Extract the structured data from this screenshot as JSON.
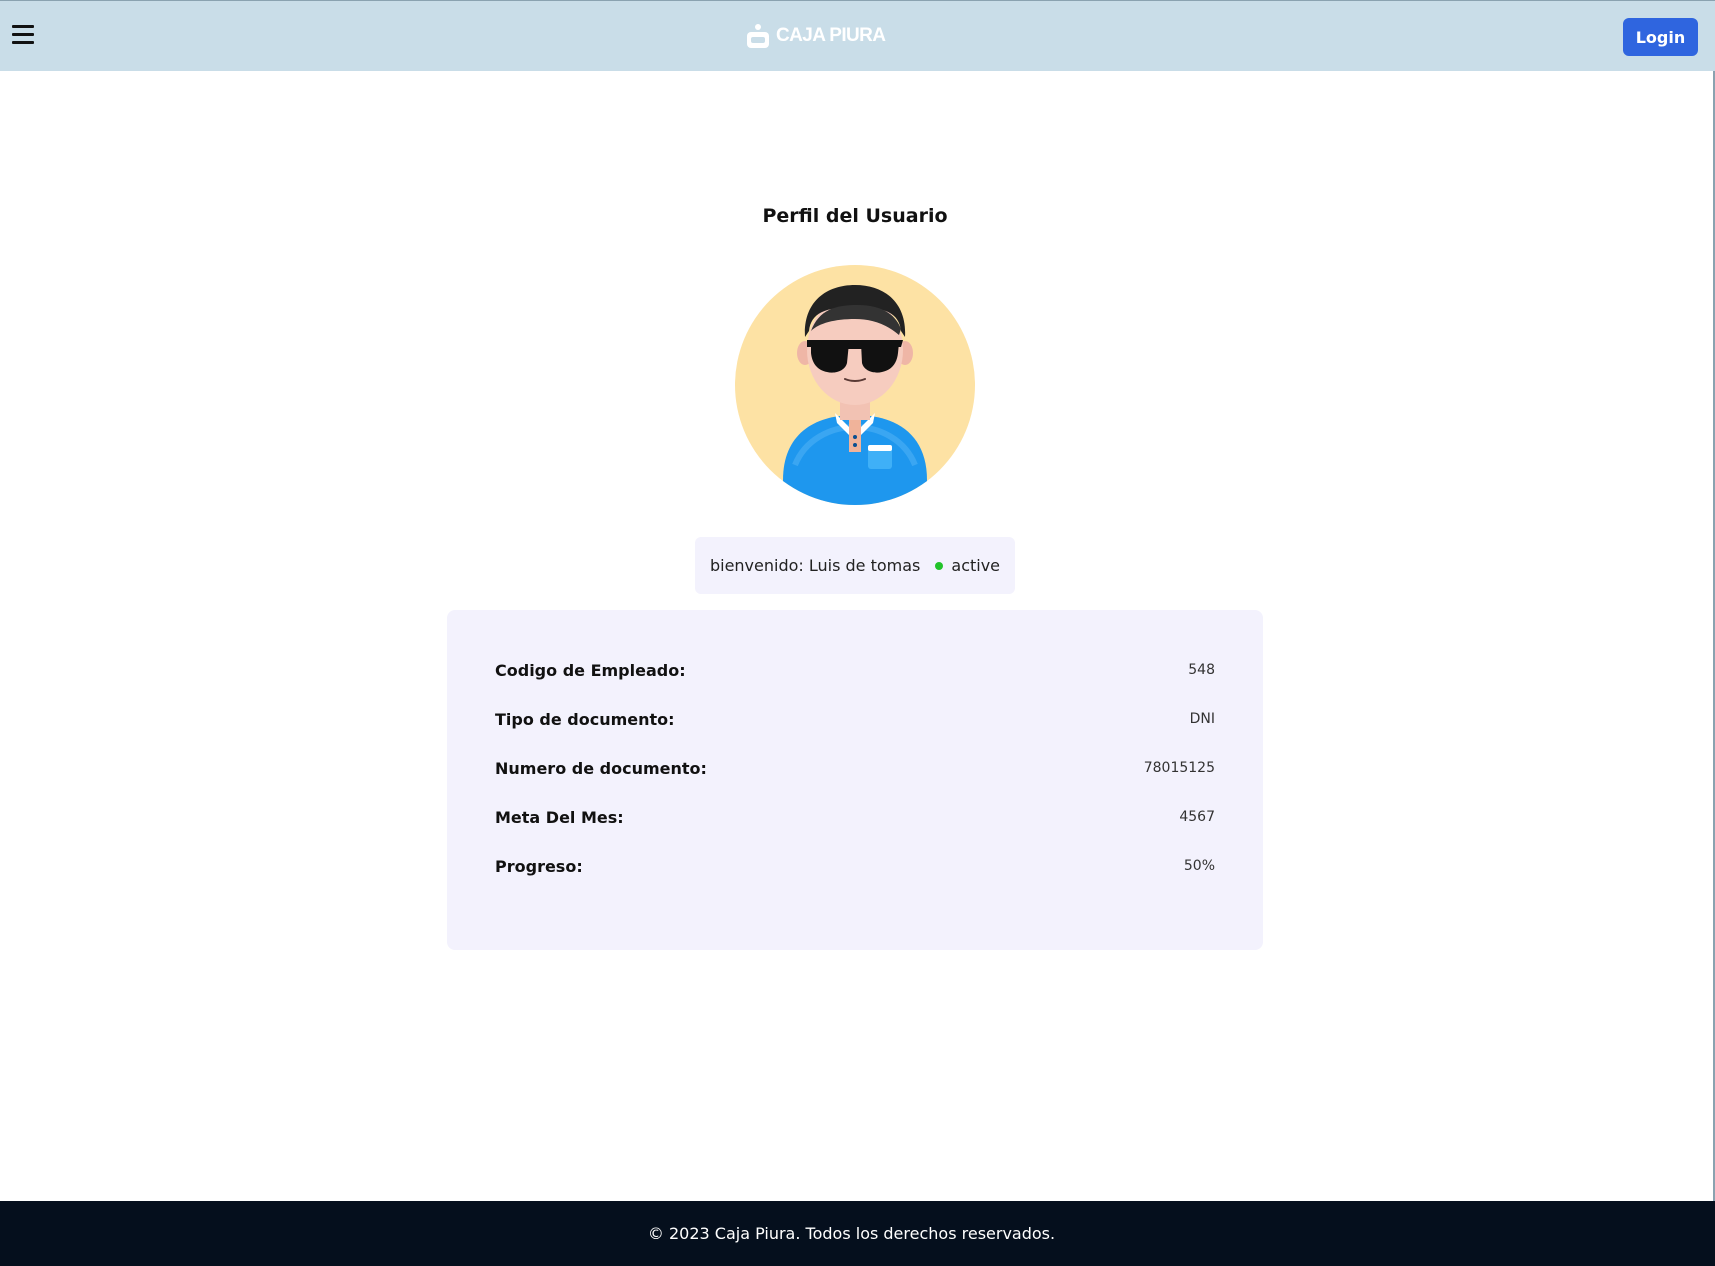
{
  "header": {
    "logo_text": "CAJA PIURA",
    "login_label": "Login",
    "background_color": "#c9dde8",
    "login_color": "#2f65df",
    "menu_icon": "hamburger-menu-icon"
  },
  "profile": {
    "title": "Perfil del Usuario",
    "avatar_icon": "user-avatar-with-sunglasses",
    "welcome_text": "bienvenido: Luis de tomas",
    "status_label": "active",
    "status_color": "#22c32a"
  },
  "info": {
    "rows": [
      {
        "label": "Codigo de Empleado:",
        "value": "548"
      },
      {
        "label": "Tipo de documento:",
        "value": "DNI"
      },
      {
        "label": "Numero de documento:",
        "value": "78015125"
      },
      {
        "label": "Meta Del Mes:",
        "value": "4567"
      },
      {
        "label": "Progreso:",
        "value": "50%"
      }
    ]
  },
  "footer": {
    "text": "© 2023 Caja Piura. Todos los derechos reservados.",
    "background_color": "#050f1d"
  }
}
